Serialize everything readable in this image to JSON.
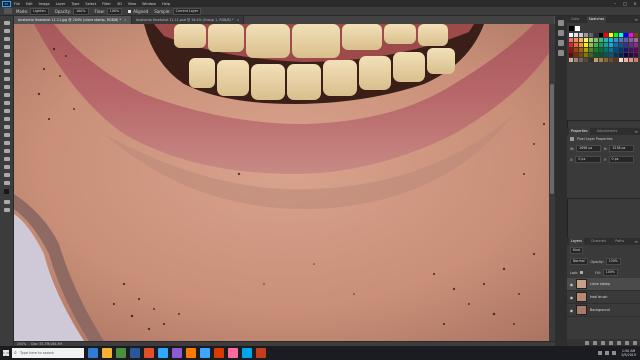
{
  "app": {
    "name": "Photoshop",
    "logo_text": "Ps"
  },
  "menubar": {
    "items": [
      "File",
      "Edit",
      "Image",
      "Layer",
      "Type",
      "Select",
      "Filter",
      "3D",
      "View",
      "Window",
      "Help"
    ]
  },
  "options_bar": {
    "mode_label": "Mode:",
    "mode_value": "Lighten",
    "opacity_label": "Opacity:",
    "opacity_value": "100%",
    "flow_label": "Flow:",
    "flow_value": "100%",
    "aligned_label": "Aligned",
    "sample_label": "Sample:",
    "sample_value": "Current Layer"
  },
  "document_tabs": [
    {
      "label": "Anatomia Headshot 11.11.jpg @ 204% (clone stamp, RGB/8) *",
      "active": true
    },
    {
      "label": "Anatomia Headshot 11.11.psd @ 16.4% (Group 1, RGB/8) *",
      "active": false
    }
  ],
  "statusbar": {
    "zoom": "204%",
    "doc": "Doc: 55.7M/186.5M"
  },
  "swatches_panel": {
    "tabs": [
      "Color",
      "Swatches"
    ],
    "active_tab": "Swatches",
    "colors": [
      "#ffffff",
      "#e6e6e6",
      "#cccccc",
      "#999999",
      "#666666",
      "#333333",
      "#000000",
      "#ff0000",
      "#ffff00",
      "#00ff00",
      "#00ffff",
      "#0000ff",
      "#ff00ff",
      "#7f3f00",
      "#f26d7d",
      "#f68e56",
      "#fbaf5c",
      "#fff568",
      "#acd372",
      "#7cc576",
      "#3bb878",
      "#1abbb4",
      "#00bff3",
      "#438ccb",
      "#5574b9",
      "#605ca8",
      "#855fa8",
      "#a763a8",
      "#ed1c24",
      "#f26522",
      "#f7941d",
      "#fff200",
      "#8dc63f",
      "#39b54a",
      "#00a651",
      "#00a99d",
      "#00aeef",
      "#0072bc",
      "#0054a6",
      "#2e3192",
      "#662d91",
      "#92278f",
      "#9e0b0f",
      "#a0410d",
      "#a36209",
      "#aba000",
      "#598527",
      "#1a7b30",
      "#007236",
      "#00746b",
      "#0076a3",
      "#004b80",
      "#003471",
      "#1b1464",
      "#440e62",
      "#630460",
      "#790000",
      "#7b2e00",
      "#7d4900",
      "#827b00",
      "#406618",
      "#005e20",
      "#005826",
      "#005952",
      "#005b7f",
      "#003663",
      "#002157",
      "#0d004c",
      "#32004b",
      "#4b0049",
      "#c7b299",
      "#998675",
      "#736357",
      "#534741",
      "#37302d",
      "#c69c6d",
      "#a67c52",
      "#8c6239",
      "#754c24",
      "#603913",
      "#f9d9d3",
      "#eab6a3",
      "#d99a84",
      "#c47f66"
    ]
  },
  "properties_panel": {
    "tabs": [
      "Properties",
      "Adjustments"
    ],
    "active_tab": "Properties",
    "title": "Pixel Layer Properties",
    "w_label": "W:",
    "w_value": "2698 px",
    "h_label": "H:",
    "h_value": "3238 px",
    "x_label": "X:",
    "x_value": "0 px",
    "y_label": "Y:",
    "y_value": "0 px"
  },
  "layers_panel": {
    "tabs": [
      "Layers",
      "Channels",
      "Paths"
    ],
    "active_tab": "Layers",
    "filter_label": "Kind",
    "blend_mode": "Normal",
    "opacity_label": "Opacity:",
    "opacity_value": "100%",
    "lock_label": "Lock:",
    "fill_label": "Fill:",
    "fill_value": "100%",
    "layers": [
      {
        "name": "clone stamp",
        "selected": true,
        "thumb": "#c9a08a"
      },
      {
        "name": "heal brush",
        "selected": false,
        "thumb": "#b88a74"
      },
      {
        "name": "Background",
        "selected": false,
        "thumb": "#a67c6a"
      }
    ]
  },
  "taskbar": {
    "search_placeholder": "Type here to search",
    "time": "1:50 AM",
    "date": "2/9/2019",
    "apps": [
      "#2d7dd2",
      "#f3b233",
      "#4a8f3c",
      "#2b579a",
      "#e34f26",
      "#31a8ff",
      "#8a5cd0",
      "#ff7a00",
      "#3ea6ff",
      "#d83b01",
      "#ff6b9a",
      "#00a4ef",
      "#c43e1c"
    ]
  },
  "colors": {
    "accent": "#31a8ff",
    "panel_bg": "#3a3a3a",
    "workspace_bg": "#535353"
  }
}
